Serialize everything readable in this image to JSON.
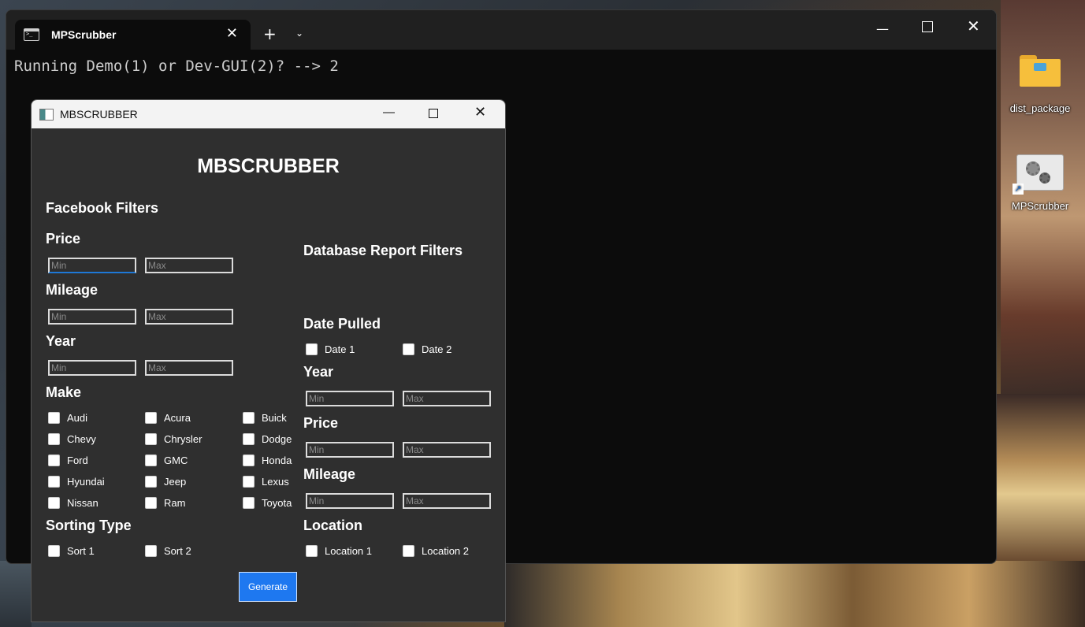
{
  "terminal": {
    "tab_title": "MPScrubber",
    "output_line": "Running Demo(1) or Dev-GUI(2)? --> 2"
  },
  "app": {
    "window_title": "MBSCRUBBER",
    "heading": "MBSCRUBBER",
    "facebook_filters": {
      "title": "Facebook Filters",
      "price_label": "Price",
      "mileage_label": "Mileage",
      "year_label": "Year",
      "min_placeholder": "Min",
      "max_placeholder": "Max",
      "make_label": "Make",
      "makes": [
        "Audi",
        "Acura",
        "Buick",
        "Chevy",
        "Chrysler",
        "Dodge",
        "Ford",
        "GMC",
        "Honda",
        "Hyundai",
        "Jeep",
        "Lexus",
        "Nissan",
        "Ram",
        "Toyota"
      ],
      "sorting_label": "Sorting Type",
      "sorts": [
        "Sort 1",
        "Sort 2"
      ]
    },
    "database_filters": {
      "title": "Database Report Filters",
      "date_label": "Date Pulled",
      "dates": [
        "Date 1",
        "Date 2"
      ],
      "year_label": "Year",
      "price_label": "Price",
      "mileage_label": "Mileage",
      "location_label": "Location",
      "locations": [
        "Location 1",
        "Location 2"
      ]
    },
    "generate_label": "Generate"
  },
  "desktop": {
    "icons": [
      {
        "label": "dist_package",
        "icon": "folder-icon"
      },
      {
        "label": "MPScrubber",
        "icon": "shortcut-gear-icon"
      }
    ]
  }
}
